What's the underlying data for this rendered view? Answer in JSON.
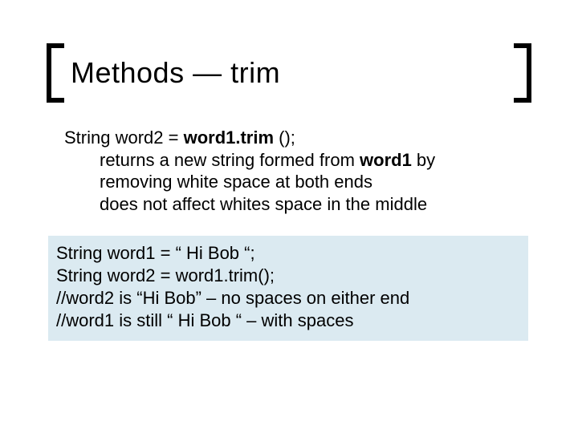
{
  "title": "Methods — trim",
  "body": {
    "line1_pre": "String word2 = ",
    "line1_bold": "word1.trim",
    "line1_post": " ();",
    "line2_pre": "returns a new string formed from ",
    "line2_bold": "word1",
    "line2_post": " by",
    "line3": "removing white space at both ends",
    "line4": "does not affect whites space in  the middle"
  },
  "code": {
    "c1": "String word1 = “ Hi Bob “;",
    "c2": "String word2 = word1.trim();",
    "c3": "//word2 is “Hi Bob” – no spaces on either end",
    "c4": "//word1 is still “ Hi Bob “ – with spaces"
  }
}
